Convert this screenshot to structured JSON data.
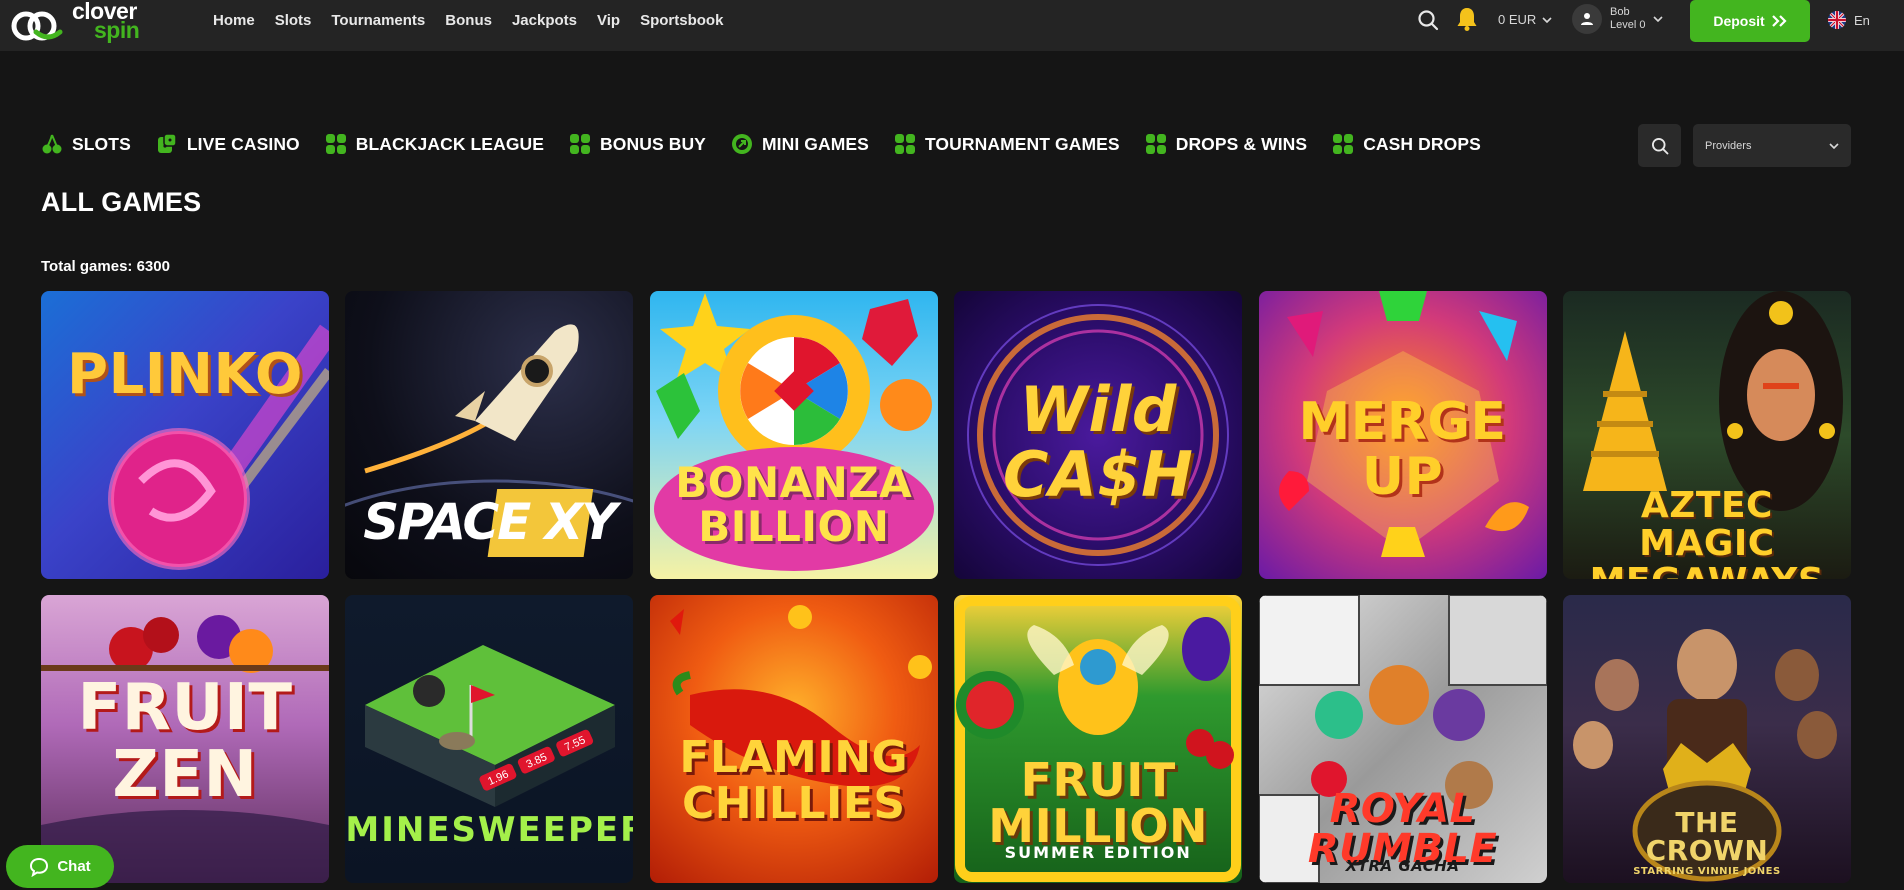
{
  "brand": {
    "line1": "clover",
    "line2": "spin",
    "color": "#43b51f"
  },
  "nav": [
    "Home",
    "Slots",
    "Tournaments",
    "Bonus",
    "Jackpots",
    "Vip",
    "Sportsbook"
  ],
  "header": {
    "balance": "0 EUR",
    "user_name": "Bob",
    "user_level": "Level 0",
    "deposit_label": "Deposit",
    "language": "En"
  },
  "categories": [
    {
      "label": "SLOTS",
      "icon": "cherry-icon"
    },
    {
      "label": "LIVE CASINO",
      "icon": "dice-icon"
    },
    {
      "label": "BLACKJACK LEAGUE",
      "icon": "grid-icon"
    },
    {
      "label": "BONUS BUY",
      "icon": "grid-icon"
    },
    {
      "label": "MINI GAMES",
      "icon": "target-icon"
    },
    {
      "label": "TOURNAMENT GAMES",
      "icon": "grid-icon"
    },
    {
      "label": "DROPS & WINS",
      "icon": "grid-icon"
    },
    {
      "label": "CASH DROPS",
      "icon": "grid-icon"
    }
  ],
  "filters": {
    "providers_placeholder": "Providers"
  },
  "section": {
    "title": "ALL GAMES",
    "total_games": "Total games: 6300"
  },
  "games": [
    {
      "title": "PLINKO"
    },
    {
      "title": "SPACE XY"
    },
    {
      "title": "BONANZA BILLION"
    },
    {
      "title": "Wild CA$H"
    },
    {
      "title": "MERGE UP"
    },
    {
      "title": "AZTEC MAGIC MEGAWAYS"
    },
    {
      "title": "FRUIT ZEN"
    },
    {
      "title": "MINESWEEPER",
      "extra": [
        "1.96",
        "3.85",
        "7.55"
      ]
    },
    {
      "title": "FLAMING CHILLIES"
    },
    {
      "title": "FRUIT MILLION",
      "subtitle": "SUMMER EDITION"
    },
    {
      "title": "ROYAL RUMBLE",
      "subtitle": "XTRA GACHA"
    },
    {
      "title": "THE CROWN",
      "subtitle": "STARRING VINNIE JONES"
    }
  ],
  "chat": {
    "label": "Chat"
  }
}
